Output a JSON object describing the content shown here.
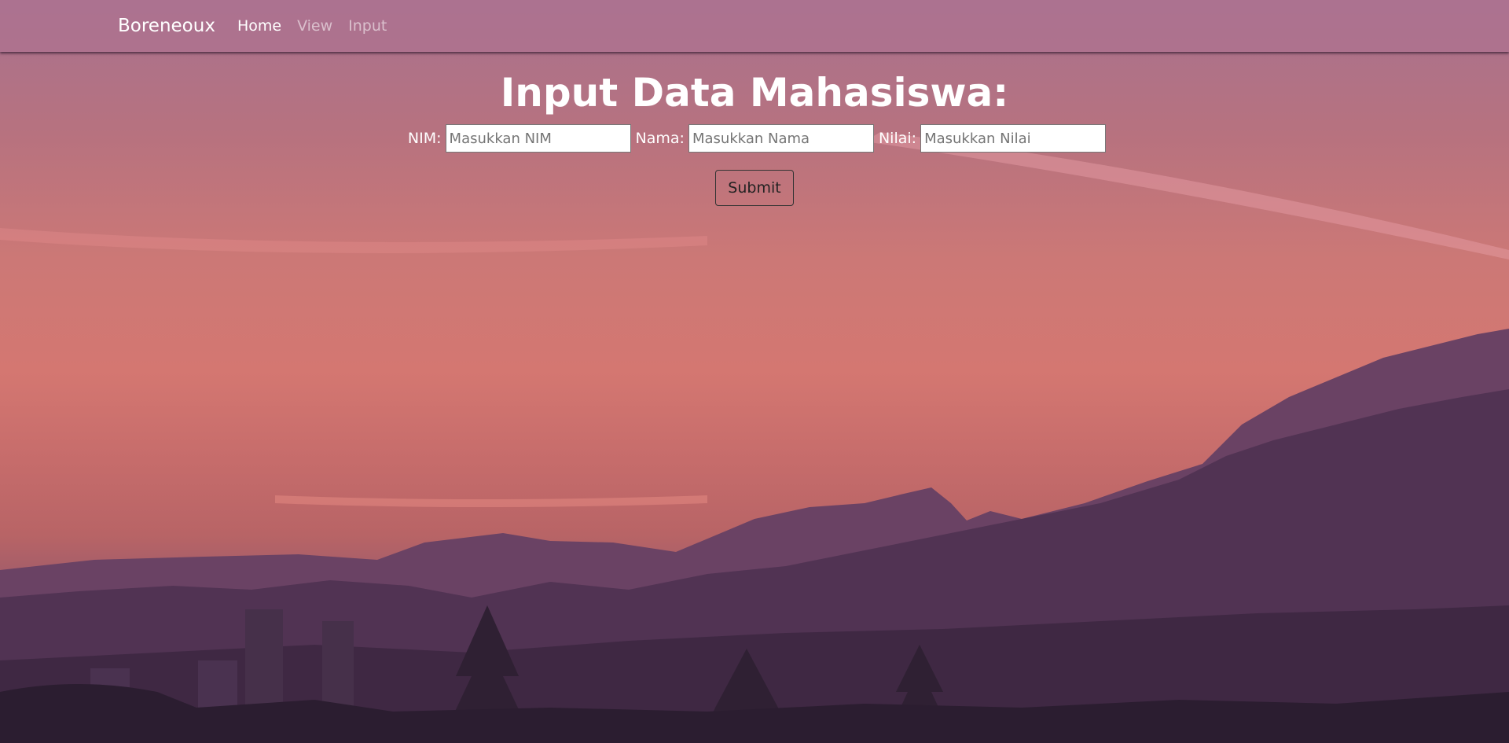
{
  "navbar": {
    "brand": "Boreneoux",
    "links": [
      {
        "label": "Home",
        "active": true
      },
      {
        "label": "View",
        "active": false
      },
      {
        "label": "Input",
        "active": false
      }
    ]
  },
  "main": {
    "title": "Input Data Mahasiswa:",
    "fields": [
      {
        "label": "NIM:",
        "placeholder": "Masukkan NIM",
        "value": ""
      },
      {
        "label": "Nama:",
        "placeholder": "Masukkan Nama",
        "value": ""
      },
      {
        "label": "Nilai:",
        "placeholder": "Masukkan Nilai",
        "value": ""
      }
    ],
    "submit_label": "Submit"
  },
  "colors": {
    "navbar_bg": "#b27891",
    "sky_top": "#a8718f",
    "sky_mid": "#d47771",
    "mountains": "#4a3050",
    "text": "#ffffff"
  }
}
